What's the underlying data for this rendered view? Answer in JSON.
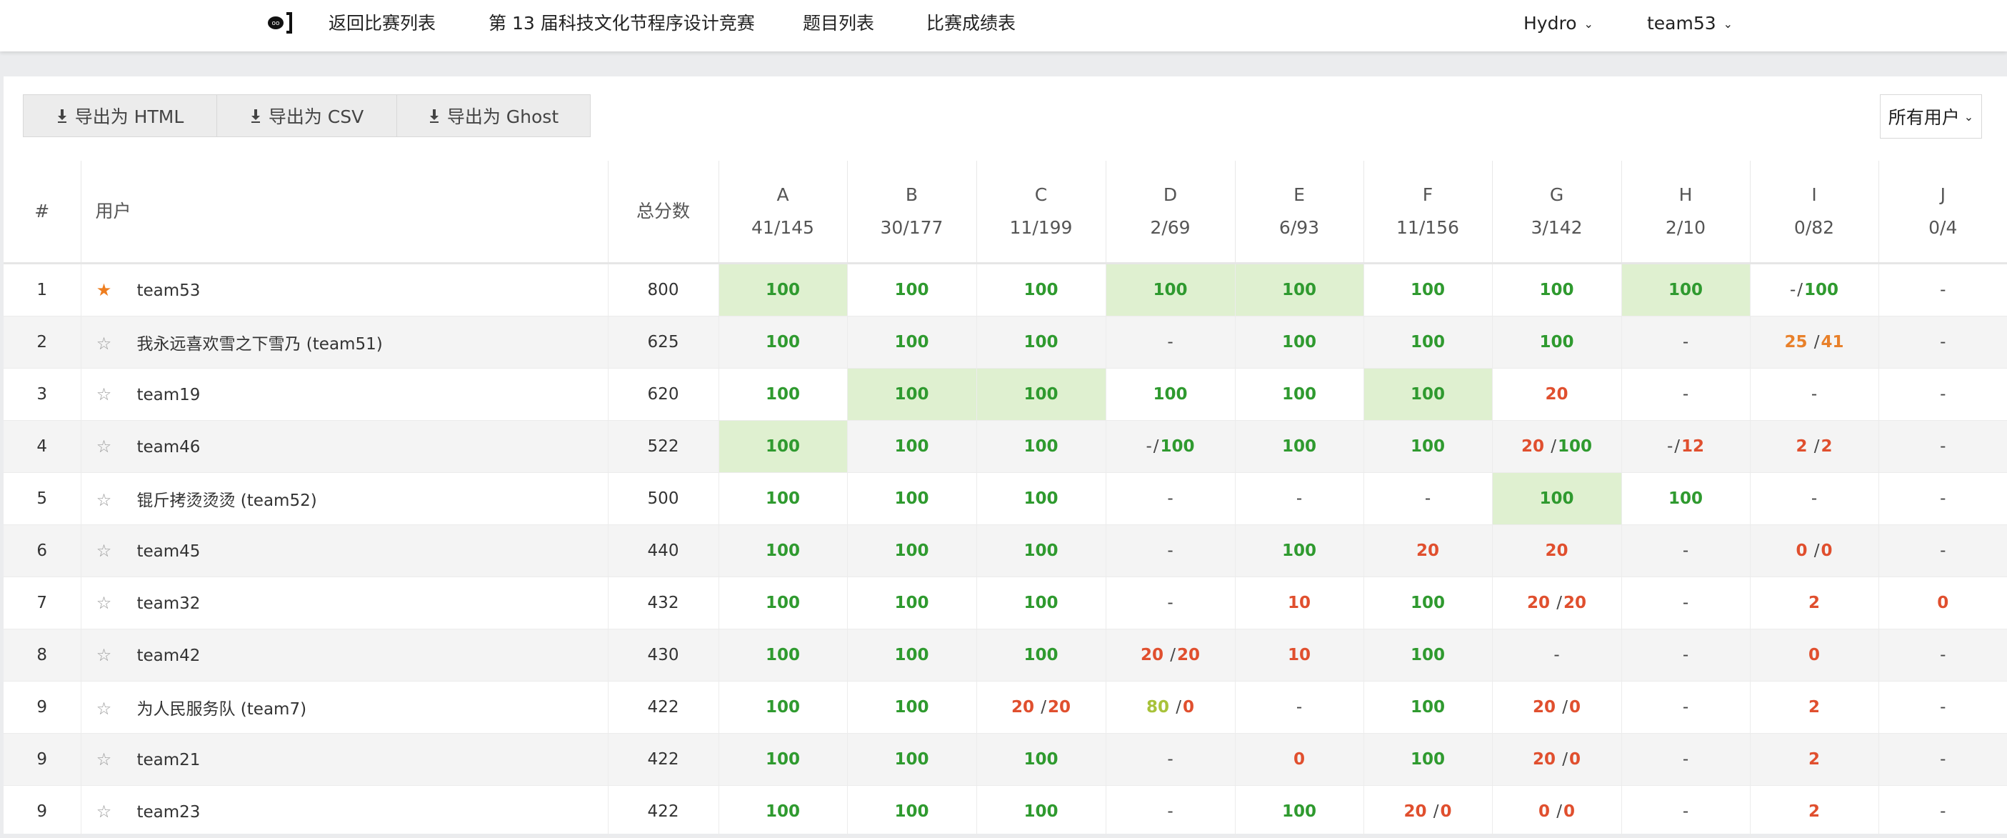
{
  "nav": {
    "items": [
      "返回比赛列表",
      "第 13 届科技文化节程序设计竞赛",
      "题目列表",
      "比赛成绩表"
    ],
    "domain": "Hydro",
    "user": "team53"
  },
  "toolbar": {
    "export_html": "导出为 HTML",
    "export_csv": "导出为 CSV",
    "export_ghost": "导出为 Ghost",
    "filter": "所有用户"
  },
  "table": {
    "headers": {
      "rank": "#",
      "user": "用户",
      "total": "总分数"
    },
    "problems": [
      {
        "id": "A",
        "stat": "41/145"
      },
      {
        "id": "B",
        "stat": "30/177"
      },
      {
        "id": "C",
        "stat": "11/199"
      },
      {
        "id": "D",
        "stat": "2/69"
      },
      {
        "id": "E",
        "stat": "6/93"
      },
      {
        "id": "F",
        "stat": "11/156"
      },
      {
        "id": "G",
        "stat": "3/142"
      },
      {
        "id": "H",
        "stat": "2/10"
      },
      {
        "id": "I",
        "stat": "0/82"
      },
      {
        "id": "J",
        "stat": "0/4"
      }
    ],
    "rows": [
      {
        "rank": "1",
        "user": "team53",
        "starred": true,
        "total": "800",
        "cells": [
          [
            "100",
            "g",
            "ac"
          ],
          [
            "100",
            "g"
          ],
          [
            "100",
            "g"
          ],
          [
            "100",
            "g",
            "ac"
          ],
          [
            "100",
            "g",
            "ac"
          ],
          [
            "100",
            "g"
          ],
          [
            "100",
            "g"
          ],
          [
            "100",
            "g",
            "ac"
          ],
          [
            "-/100",
            "mix",
            "-",
            "100",
            "g"
          ],
          [
            "-",
            "dash"
          ]
        ]
      },
      {
        "rank": "2",
        "user": "我永远喜欢雪之下雪乃 (team51)",
        "starred": false,
        "total": "625",
        "cells": [
          [
            "100",
            "g"
          ],
          [
            "100",
            "g"
          ],
          [
            "100",
            "g"
          ],
          [
            "-",
            "dash"
          ],
          [
            "100",
            "g"
          ],
          [
            "100",
            "g"
          ],
          [
            "100",
            "g"
          ],
          [
            "-",
            "dash"
          ],
          [
            "25 /41",
            "mix",
            "25",
            "41",
            "o"
          ],
          [
            "-",
            "dash"
          ]
        ]
      },
      {
        "rank": "3",
        "user": "team19",
        "starred": false,
        "total": "620",
        "cells": [
          [
            "100",
            "g"
          ],
          [
            "100",
            "g",
            "ac"
          ],
          [
            "100",
            "g",
            "ac"
          ],
          [
            "100",
            "g"
          ],
          [
            "100",
            "g"
          ],
          [
            "100",
            "g",
            "ac"
          ],
          [
            "20",
            "r"
          ],
          [
            "-",
            "dash"
          ],
          [
            "-",
            "dash"
          ],
          [
            "-",
            "dash"
          ]
        ]
      },
      {
        "rank": "4",
        "user": "team46",
        "starred": false,
        "total": "522",
        "cells": [
          [
            "100",
            "g",
            "ac"
          ],
          [
            "100",
            "g"
          ],
          [
            "100",
            "g"
          ],
          [
            "-/100",
            "mix",
            "-",
            "100",
            "g"
          ],
          [
            "100",
            "g"
          ],
          [
            "100",
            "g"
          ],
          [
            "20 /100",
            "mix",
            "20",
            "100",
            "g"
          ],
          [
            "-/12",
            "mix",
            "-",
            "12",
            "r"
          ],
          [
            "2 /2",
            "mix",
            "2",
            "2",
            "r"
          ],
          [
            "-",
            "dash"
          ]
        ]
      },
      {
        "rank": "5",
        "user": "锟斤拷烫烫烫 (team52)",
        "starred": false,
        "total": "500",
        "cells": [
          [
            "100",
            "g"
          ],
          [
            "100",
            "g"
          ],
          [
            "100",
            "g"
          ],
          [
            "-",
            "dash"
          ],
          [
            "-",
            "dash"
          ],
          [
            "-",
            "dash"
          ],
          [
            "100",
            "g",
            "ac"
          ],
          [
            "100",
            "g"
          ],
          [
            "-",
            "dash"
          ],
          [
            "-",
            "dash"
          ]
        ]
      },
      {
        "rank": "6",
        "user": "team45",
        "starred": false,
        "total": "440",
        "cells": [
          [
            "100",
            "g"
          ],
          [
            "100",
            "g"
          ],
          [
            "100",
            "g"
          ],
          [
            "-",
            "dash"
          ],
          [
            "100",
            "g"
          ],
          [
            "20",
            "r"
          ],
          [
            "20",
            "r"
          ],
          [
            "-",
            "dash"
          ],
          [
            "0 /0",
            "mix",
            "0",
            "0",
            "r"
          ],
          [
            "-",
            "dash"
          ]
        ]
      },
      {
        "rank": "7",
        "user": "team32",
        "starred": false,
        "total": "432",
        "cells": [
          [
            "100",
            "g"
          ],
          [
            "100",
            "g"
          ],
          [
            "100",
            "g"
          ],
          [
            "-",
            "dash"
          ],
          [
            "10",
            "r"
          ],
          [
            "100",
            "g"
          ],
          [
            "20 /20",
            "mix",
            "20",
            "20",
            "r"
          ],
          [
            "-",
            "dash"
          ],
          [
            "2",
            "r"
          ],
          [
            "0",
            "r"
          ]
        ]
      },
      {
        "rank": "8",
        "user": "team42",
        "starred": false,
        "total": "430",
        "cells": [
          [
            "100",
            "g"
          ],
          [
            "100",
            "g"
          ],
          [
            "100",
            "g"
          ],
          [
            "20 /20",
            "mix",
            "20",
            "20",
            "r"
          ],
          [
            "10",
            "r"
          ],
          [
            "100",
            "g"
          ],
          [
            "-",
            "dash"
          ],
          [
            "-",
            "dash"
          ],
          [
            "0",
            "r"
          ],
          [
            "-",
            "dash"
          ]
        ]
      },
      {
        "rank": "9",
        "user": "为人民服务队 (team7)",
        "starred": false,
        "total": "422",
        "cells": [
          [
            "100",
            "g"
          ],
          [
            "100",
            "g"
          ],
          [
            "20 /20",
            "mix",
            "20",
            "20",
            "r"
          ],
          [
            "80 /0",
            "mixy",
            "80",
            "0",
            "r"
          ],
          [
            "-",
            "dash"
          ],
          [
            "100",
            "g"
          ],
          [
            "20 /0",
            "mix",
            "20",
            "0",
            "r"
          ],
          [
            "-",
            "dash"
          ],
          [
            "2",
            "r"
          ],
          [
            "-",
            "dash"
          ]
        ]
      },
      {
        "rank": "9",
        "user": "team21",
        "starred": false,
        "total": "422",
        "cells": [
          [
            "100",
            "g"
          ],
          [
            "100",
            "g"
          ],
          [
            "100",
            "g"
          ],
          [
            "-",
            "dash"
          ],
          [
            "0",
            "r"
          ],
          [
            "100",
            "g"
          ],
          [
            "20 /0",
            "mix",
            "20",
            "0",
            "r"
          ],
          [
            "-",
            "dash"
          ],
          [
            "2",
            "r"
          ],
          [
            "-",
            "dash"
          ]
        ]
      },
      {
        "rank": "9",
        "user": "team23",
        "starred": false,
        "total": "422",
        "cells": [
          [
            "100",
            "g"
          ],
          [
            "100",
            "g"
          ],
          [
            "100",
            "g"
          ],
          [
            "-",
            "dash"
          ],
          [
            "100",
            "g"
          ],
          [
            "20 /0",
            "mix",
            "20",
            "0",
            "r"
          ],
          [
            "0 /0",
            "mix",
            "0",
            "0",
            "r"
          ],
          [
            "-",
            "dash"
          ],
          [
            "2",
            "r"
          ],
          [
            "-",
            "dash"
          ]
        ]
      }
    ]
  }
}
